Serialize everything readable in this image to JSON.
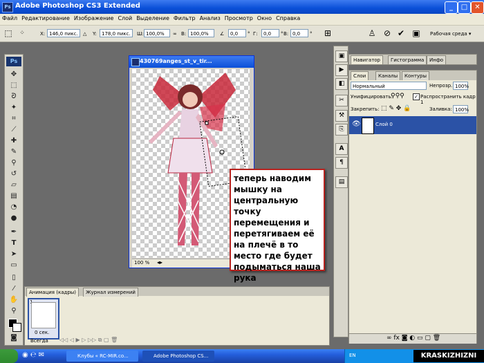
{
  "window": {
    "title": "Adobe Photoshop CS3 Extended",
    "icon": "ps-app-icon",
    "min": "_",
    "max": "□",
    "close": "✕",
    "ps_logo": "Ps"
  },
  "menu": [
    "Файл",
    "Редактирование",
    "Изображение",
    "Слой",
    "Выделение",
    "Фильтр",
    "Анализ",
    "Просмотр",
    "Окно",
    "Справка"
  ],
  "options": {
    "x_label": "X:",
    "x_value": "146,0 пикс.",
    "y_label": "Y:",
    "y_value": "178,0 пикс.",
    "w_label": "Ш:",
    "w_value": "100,0%",
    "h_label": "В:",
    "h_value": "100,0%",
    "angle_label": "∠",
    "angle_value": "0,0",
    "hskew_label": "Г:",
    "hskew_value": "0,0",
    "vskew_label": "В:",
    "vskew_value": "0,0",
    "workspace": "Рабочая среда ▾",
    "unit": "°"
  },
  "document": {
    "title": "430769anges_st_v_tir...",
    "zoom": "100 %"
  },
  "annotation": {
    "text": "теперь наводим мышку на центральную точку перемещения и перетягиваем её на плечё в то место где будет подыматься наша рука"
  },
  "panels": {
    "top_tabs": [
      "Навигатор",
      "Гистограмма",
      "Инфо"
    ],
    "layer_tabs": [
      "Слои",
      "Каналы",
      "Контуры"
    ],
    "blend_mode": "Нормальный",
    "opacity_label": "Непрозр.:",
    "opacity_value": "100%",
    "unify_label": "Унифицировать:",
    "propagate_label": "Распространить кадр 1",
    "lock_label": "Закрепить:",
    "fill_label": "Заливка:",
    "fill_value": "100%",
    "layer_name": "Слой 0"
  },
  "animation": {
    "tabs": [
      "Анимация (кадры)",
      "Журнал измерений"
    ],
    "frame_number": "1",
    "frame_delay": "0 сек.",
    "loop": "Всегда"
  },
  "taskbar": {
    "tasks": [
      "Клубы « RC-MIR.co...",
      "Adobe Photoshop CS..."
    ],
    "lang": "EN"
  },
  "watermark": "KRASKIZHIZNI",
  "colors": {
    "accent": "#0a4fd8",
    "note_border": "#b8221e",
    "layer_selected": "#2b52a6"
  }
}
